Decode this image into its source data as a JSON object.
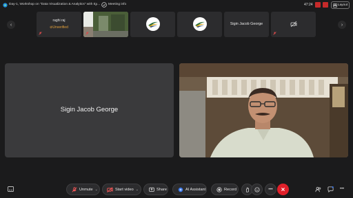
{
  "titlebar": {
    "title": "Day-1, Workshop on \"Data Visualization & Analytics\" with Ex...",
    "meeting_info": "Meeting info",
    "time": "47:24",
    "layout_label": "Layout"
  },
  "filmstrip": {
    "participants": [
      {
        "name": "raghi raj",
        "status": "Unverified"
      },
      {
        "kind": "video"
      },
      {
        "kind": "logo"
      },
      {
        "kind": "logo"
      },
      {
        "name": "Sigin Jacob George"
      },
      {
        "kind": "video-off"
      }
    ]
  },
  "main": {
    "left_tile_name": "Sigin Jacob George"
  },
  "toolbar": {
    "unmute": "Unmute",
    "start_video": "Start video",
    "share": "Share",
    "ai_assistant": "AI Assistant",
    "record": "Record"
  },
  "colors": {
    "background": "#1b1b1c",
    "leave_red": "#e0202a",
    "unverified_orange": "#e5a23a"
  }
}
